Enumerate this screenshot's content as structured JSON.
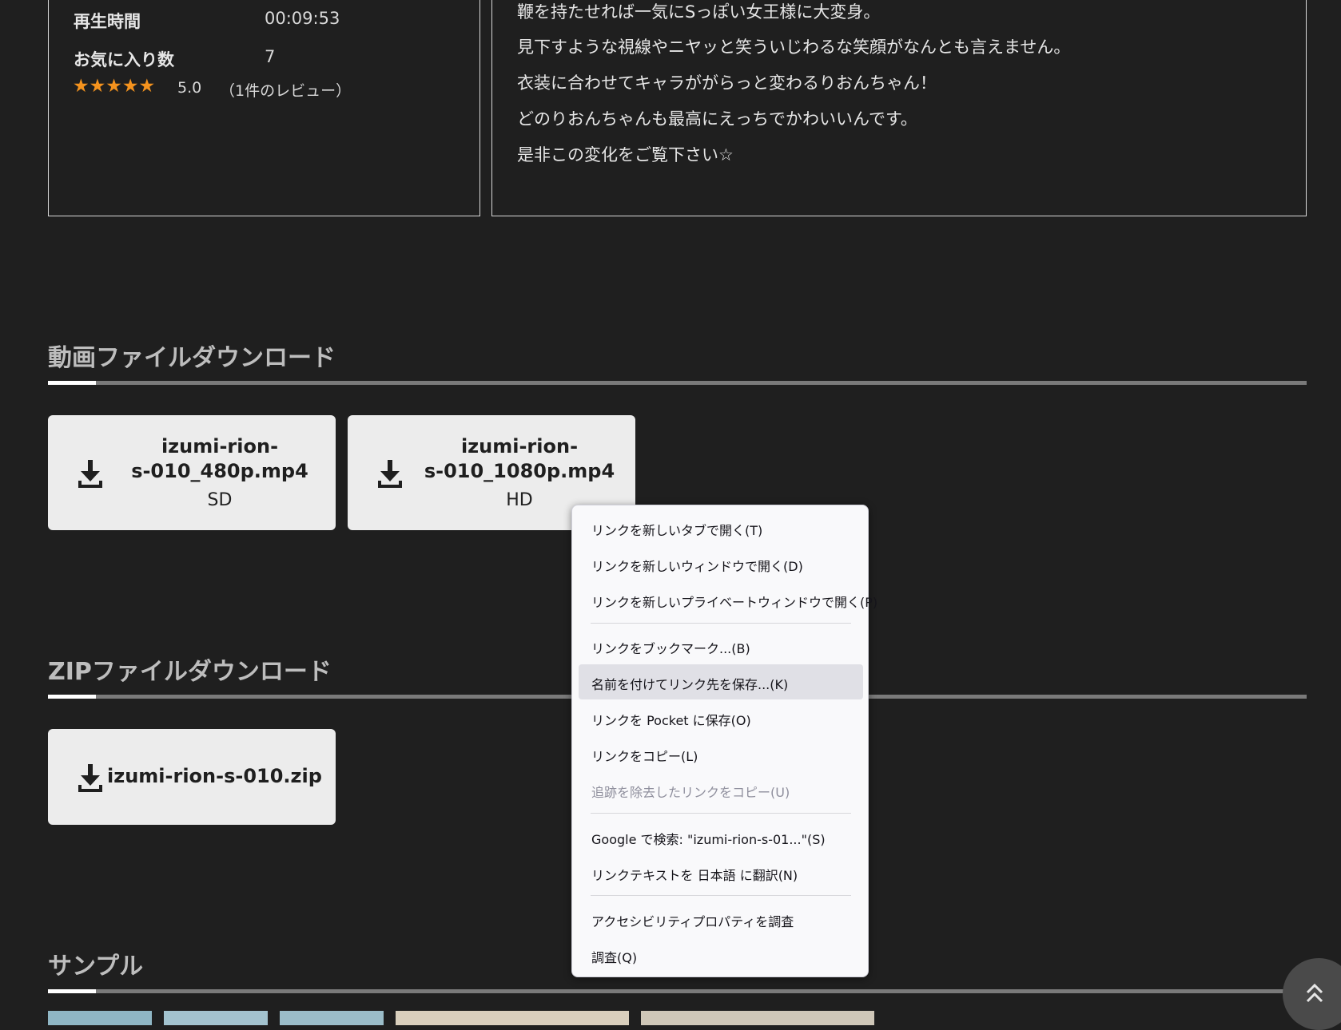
{
  "info": {
    "rows": [
      {
        "label": "再生時間",
        "value": "00:09:53"
      },
      {
        "label": "お気に入り数",
        "value": "7"
      }
    ],
    "stars": "★★★★★",
    "rating": "5.0",
    "reviews": "（1件のレビュー）"
  },
  "description": {
    "lines": [
      "鞭を持たせれば一気にSっぽい女王様に大変身。",
      "見下すような視線やニヤッと笑ういじわるな笑顔がなんとも言えません。",
      "衣装に合わせてキャラががらっと変わるりおんちゃん！",
      "どのりおんちゃんも最高にえっちでかわいいんです。",
      "是非この変化をご覧下さい☆"
    ]
  },
  "video_section": {
    "title": "動画ファイルダウンロード",
    "buttons": [
      {
        "line1": "izumi-rion-",
        "line2": "s-010_480p.mp4",
        "quality": "SD"
      },
      {
        "line1": "izumi-rion-",
        "line2": "s-010_1080p.mp4",
        "quality": "HD"
      }
    ]
  },
  "zip_section": {
    "title": "ZIPファイルダウンロード",
    "button": {
      "filename": "izumi-rion-s-010.zip"
    }
  },
  "sample_section": {
    "title": "サンプル"
  },
  "context_menu": {
    "items": [
      "リンクを新しいタブで開く(T)",
      "リンクを新しいウィンドウで開く(D)",
      "リンクを新しいプライベートウィンドウで開く(P)",
      "リンクをブックマーク...(B)",
      "名前を付けてリンク先を保存...(K)",
      "リンクを Pocket に保存(O)",
      "リンクをコピー(L)",
      "追跡を除去したリンクをコピー(U)",
      "Google で検索: \"izumi-rion-s-01...\"(S)",
      "リンクテキストを 日本語 に翻訳(N)",
      "アクセシビリティプロパティを調査",
      "調査(Q)"
    ],
    "highlighted_index": 4,
    "disabled_index": 7
  },
  "icons": {
    "download": "download-icon",
    "scroll_top": "double-chevron-up-icon"
  },
  "colors": {
    "background": "#1f1f1f",
    "star": "#f5931e",
    "button_bg": "#ececec",
    "menu_bg": "#f9f9fb",
    "menu_highlight": "#e0e0e6"
  }
}
